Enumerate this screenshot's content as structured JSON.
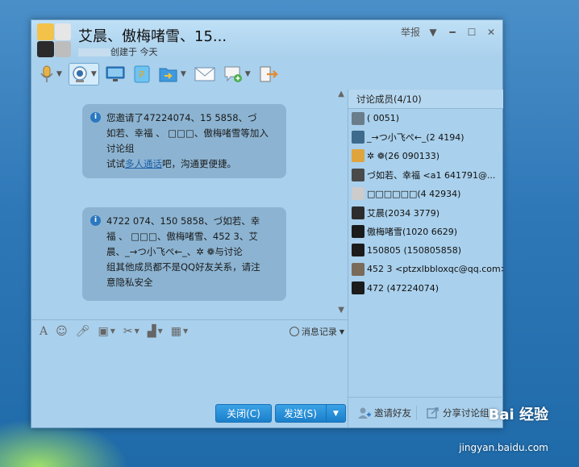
{
  "window": {
    "title": "艾晨、傲梅啫雪、15...",
    "subtitle": "创建于 今天",
    "report": "举报"
  },
  "toolbar": {
    "icons": [
      "voice-icon",
      "camera-icon",
      "screen-share-icon",
      "flag-icon",
      "folder-icon",
      "mail-icon",
      "notes-icon",
      "exit-icon"
    ]
  },
  "messages": [
    {
      "lines": [
        "您邀请了47224074、15      5858、づ",
        "如若、幸福 、   □□□、傲梅啫雪等加入",
        "讨论组"
      ],
      "try_prefix": "试试",
      "link": "多人通话",
      "try_suffix": "吧，沟通更便捷。"
    },
    {
      "lines": [
        "4722  074、150     5858、づ如若、幸",
        "福 、   □□□、傲梅啫雪、452    3、艾",
        "晨、_→つ小飞ぺ←_、✲          ❁与讨论",
        "组其他成员都不是QQ好友关系，请注",
        "意隐私安全"
      ]
    }
  ],
  "input_toolbar": {
    "history": "消息记录"
  },
  "buttons": {
    "close": "关闭(C)",
    "send": "发送(S)"
  },
  "members": {
    "title": "讨论成员(4/10)",
    "list": [
      {
        "name": "(       0051)",
        "color": "#6a7d8a"
      },
      {
        "name": "_→つ小飞ぺ←_(2        4194)",
        "color": "#3e6b8c"
      },
      {
        "name": "✲          ❁(26    090133)",
        "color": "#e0a43c"
      },
      {
        "name": "づ如若、幸福 <a1    641791@...",
        "color": "#4a4a4a"
      },
      {
        "name": "□□□□□□(4     42934)",
        "color": "#cccccc"
      },
      {
        "name": "艾晨(2034     3779)",
        "color": "#2d2d2d"
      },
      {
        "name": "傲梅啫雪(1020   6629)",
        "color": "#1b1b1b"
      },
      {
        "name": "150805    (150805858)",
        "color": "#1b1b1b"
      },
      {
        "name": "452    3 <ptzxlbbloxqc@qq.com>",
        "color": "#7a6a5a"
      },
      {
        "name": "472       (47224074)",
        "color": "#1b1b1b"
      }
    ],
    "invite": "邀请好友",
    "share": "分享讨论组"
  },
  "watermark": {
    "brand": "Bai  经验",
    "url": "jingyan.baidu.com"
  }
}
